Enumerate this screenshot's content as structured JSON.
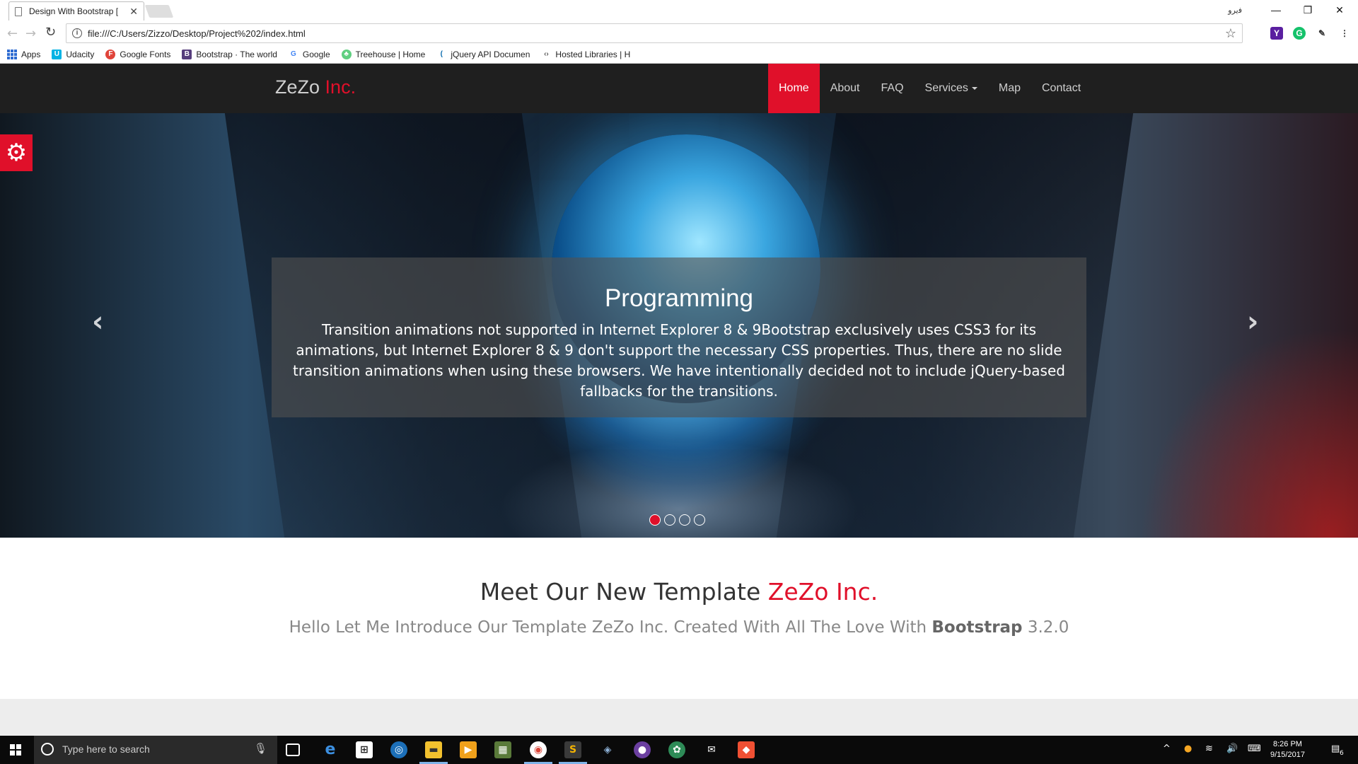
{
  "browser": {
    "tab_title": "Design With Bootstrap [",
    "tab_close": "✕",
    "user_name": "ﻓﯾﺮﻭ",
    "url": "file:///C:/Users/Zizzo/Desktop/Project%202/index.html",
    "window_controls": {
      "minimize": "—",
      "restore": "❐",
      "close": "✕"
    }
  },
  "bookmarks": [
    {
      "label": "Apps",
      "icon": "apps-grid-icon"
    },
    {
      "label": "Udacity",
      "icon": "udacity-icon",
      "glyph": "U",
      "color": "#02b3e4"
    },
    {
      "label": "Google Fonts",
      "icon": "google-fonts-icon",
      "glyph": "F",
      "color": "#e0443a"
    },
    {
      "label": "Bootstrap · The world",
      "icon": "bootstrap-icon",
      "glyph": "B",
      "color": "#563d7c"
    },
    {
      "label": "Google",
      "icon": "google-icon",
      "glyph": "G",
      "color": "#4285f4"
    },
    {
      "label": "Treehouse | Home",
      "icon": "treehouse-icon",
      "glyph": "♣",
      "color": "#5fcf80"
    },
    {
      "label": "jQuery API Documen",
      "icon": "jquery-icon",
      "glyph": "(",
      "color": "#0769ad"
    },
    {
      "label": "Hosted Libraries  |  H",
      "icon": "hosted-libraries-icon",
      "glyph": "‹›",
      "color": "#777777"
    }
  ],
  "site": {
    "brand_main": "ZeZo",
    "brand_accent": "Inc.",
    "accent_color": "#e0102a",
    "nav": [
      {
        "label": "Home",
        "active": true
      },
      {
        "label": "About"
      },
      {
        "label": "FAQ"
      },
      {
        "label": "Services"
      },
      {
        "label": "Map"
      },
      {
        "label": "Contact"
      }
    ]
  },
  "carousel": {
    "title": "Programming",
    "text": "Transition animations not supported in Internet Explorer 8 & 9Bootstrap exclusively uses CSS3 for its animations, but Internet Explorer 8 & 9 don't support the necessary CSS properties. Thus, there are no slide transition animations when using these browsers. We have intentionally decided not to include jQuery-based fallbacks for the transitions.",
    "prev_arrow": "‹",
    "next_arrow": "›",
    "settings_glyph": "⚙",
    "slide_count": 4,
    "active_slide": 1
  },
  "intro": {
    "heading_main": "Meet Our New Template ",
    "heading_accent": "ZeZo Inc.",
    "lead_before": "Hello Let Me Introduce Our Template ZeZo Inc. Created With All The Love With ",
    "lead_bold": "Bootstrap",
    "lead_after": " 3.2.0"
  },
  "taskbar": {
    "search_placeholder": "Type here to search",
    "time": "8:26 PM",
    "date": "9/15/2017",
    "notification_count": "6"
  }
}
